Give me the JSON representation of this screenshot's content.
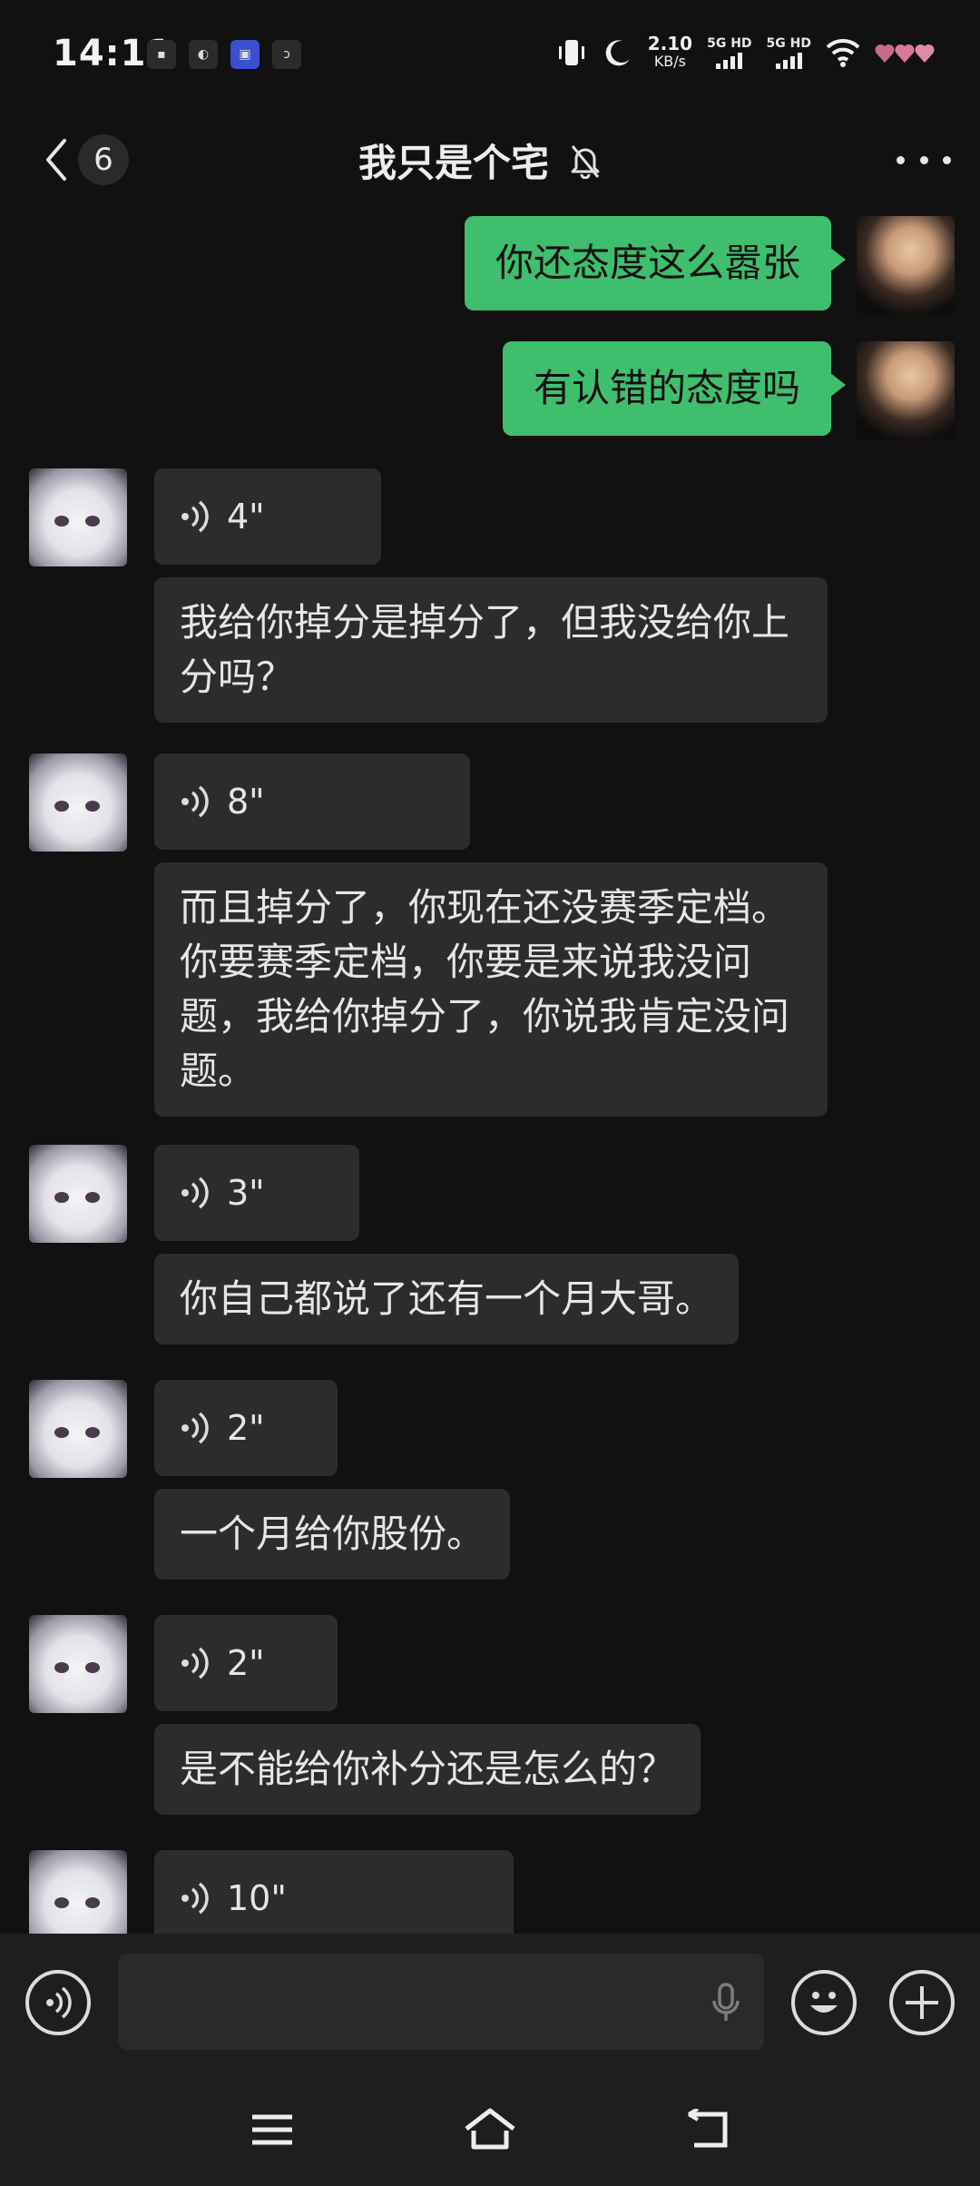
{
  "status_bar": {
    "time": "14:11",
    "net_speed_value": "2.10",
    "net_speed_unit": "KB/s",
    "sim1": "5G HD",
    "sim2": "5G HD"
  },
  "header": {
    "unread_count": "6",
    "title": "我只是个宅"
  },
  "messages": [
    {
      "side": "me",
      "type": "text",
      "text": "你还态度这么嚣张"
    },
    {
      "side": "me",
      "type": "text",
      "text": "有认错的态度吗"
    },
    {
      "side": "other",
      "type": "voice",
      "duration": "4\""
    },
    {
      "side": "other",
      "type": "text",
      "text": "我给你掉分是掉分了，但我没给你上分吗？"
    },
    {
      "side": "other",
      "type": "voice",
      "duration": "8\""
    },
    {
      "side": "other",
      "type": "text",
      "text": "而且掉分了，你现在还没赛季定档。你要赛季定档，你要是来说我没问题，我给你掉分了，你说我肯定没问题。"
    },
    {
      "side": "other",
      "type": "voice",
      "duration": "3\""
    },
    {
      "side": "other",
      "type": "text",
      "text": "你自己都说了还有一个月大哥。"
    },
    {
      "side": "other",
      "type": "voice",
      "duration": "2\""
    },
    {
      "side": "other",
      "type": "text",
      "text": "一个月给你股份。"
    },
    {
      "side": "other",
      "type": "voice",
      "duration": "2\""
    },
    {
      "side": "other",
      "type": "text",
      "text": "是不能给你补分还是怎么的？"
    },
    {
      "side": "other",
      "type": "voice",
      "duration": "10\""
    }
  ],
  "input": {
    "placeholder": ""
  },
  "colors": {
    "background": "#111111",
    "my_bubble": "#3fbf6e",
    "other_bubble": "#2c2c2c",
    "bar": "#1e1e1e"
  }
}
